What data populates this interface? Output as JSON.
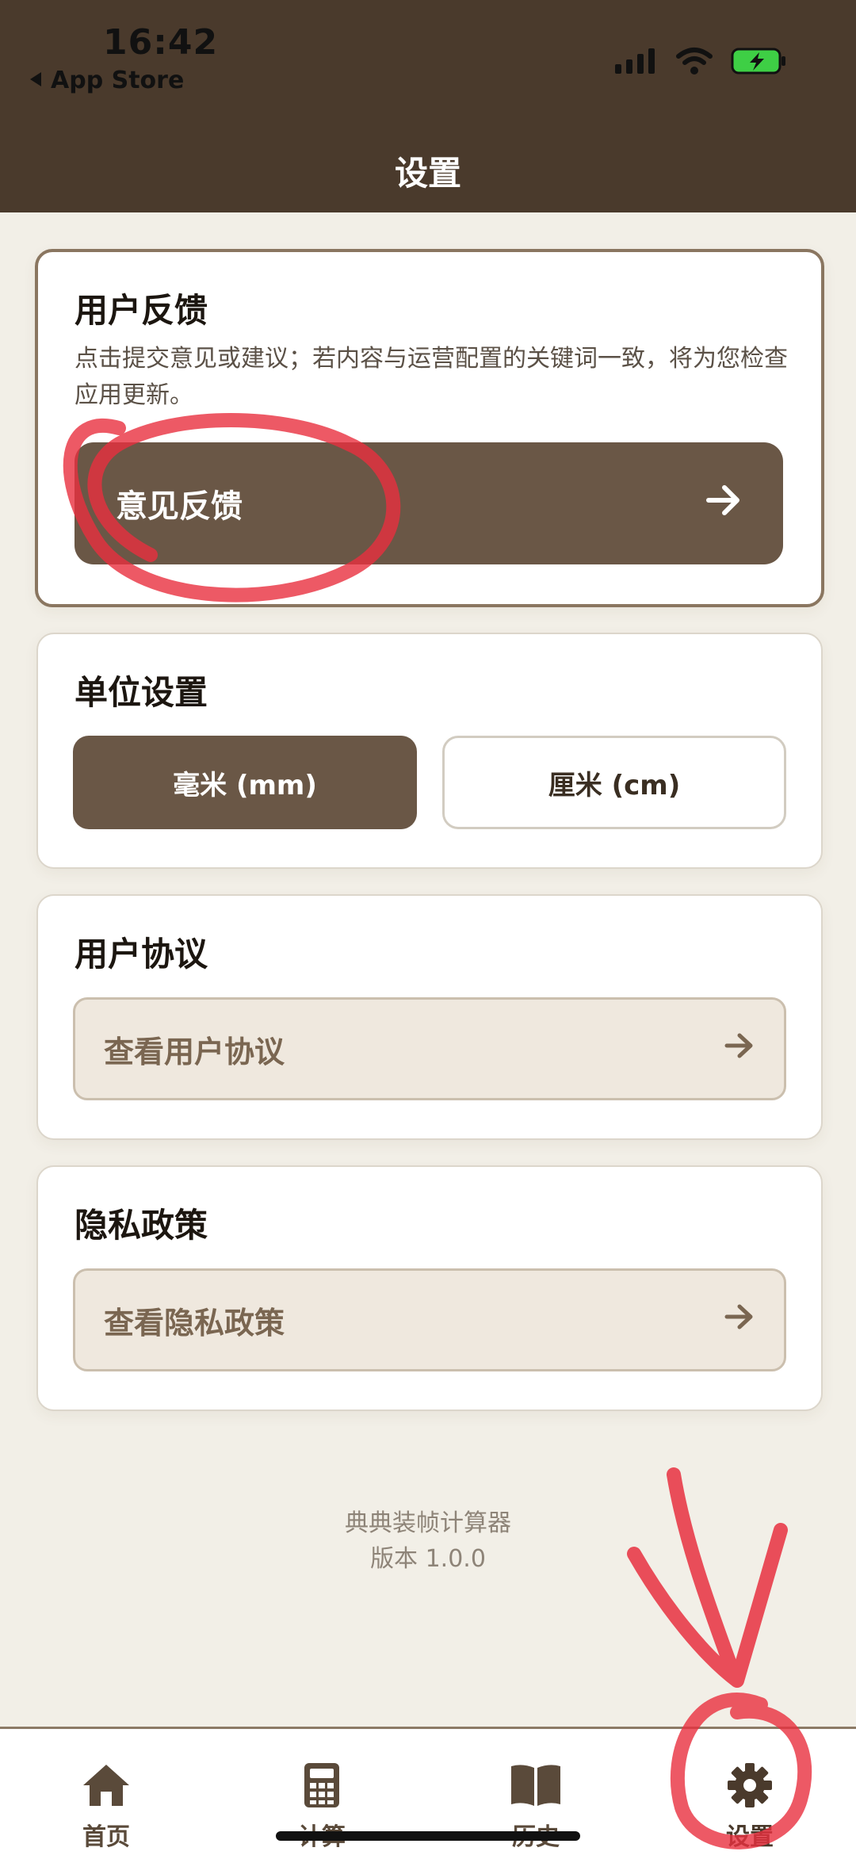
{
  "status_bar": {
    "time": "16:42",
    "back_label": "App Store",
    "icons": [
      "cellular-signal-icon",
      "wifi-icon",
      "battery-charging-icon"
    ]
  },
  "header": {
    "title": "设置"
  },
  "feedback_card": {
    "title": "用户反馈",
    "description": "点击提交意见或建议；若内容与运营配置的关键词一致，将为您检查应用更新。",
    "button_label": "意见反馈",
    "button_icon": "arrow-right-icon"
  },
  "units_card": {
    "title": "单位设置",
    "options": [
      {
        "label": "毫米 (mm)",
        "selected": true
      },
      {
        "label": "厘米 (cm)",
        "selected": false
      }
    ]
  },
  "agreement_card": {
    "title": "用户协议",
    "link_label": "查看用户协议",
    "link_icon": "arrow-right-icon"
  },
  "privacy_card": {
    "title": "隐私政策",
    "link_label": "查看隐私政策",
    "link_icon": "arrow-right-icon"
  },
  "footer": {
    "app_name": "典典装帧计算器",
    "version": "版本 1.0.0"
  },
  "tab_bar": {
    "tabs": [
      {
        "label": "首页",
        "icon": "home-icon",
        "active": false
      },
      {
        "label": "计算",
        "icon": "calculator-icon",
        "active": false
      },
      {
        "label": "历史",
        "icon": "book-icon",
        "active": false
      },
      {
        "label": "设置",
        "icon": "gear-icon",
        "active": true
      }
    ]
  },
  "colors": {
    "header_bg": "#4a3a2c",
    "accent": "#6a5746",
    "page_bg": "#f2efe7",
    "annotation_red": "#e8303f"
  }
}
